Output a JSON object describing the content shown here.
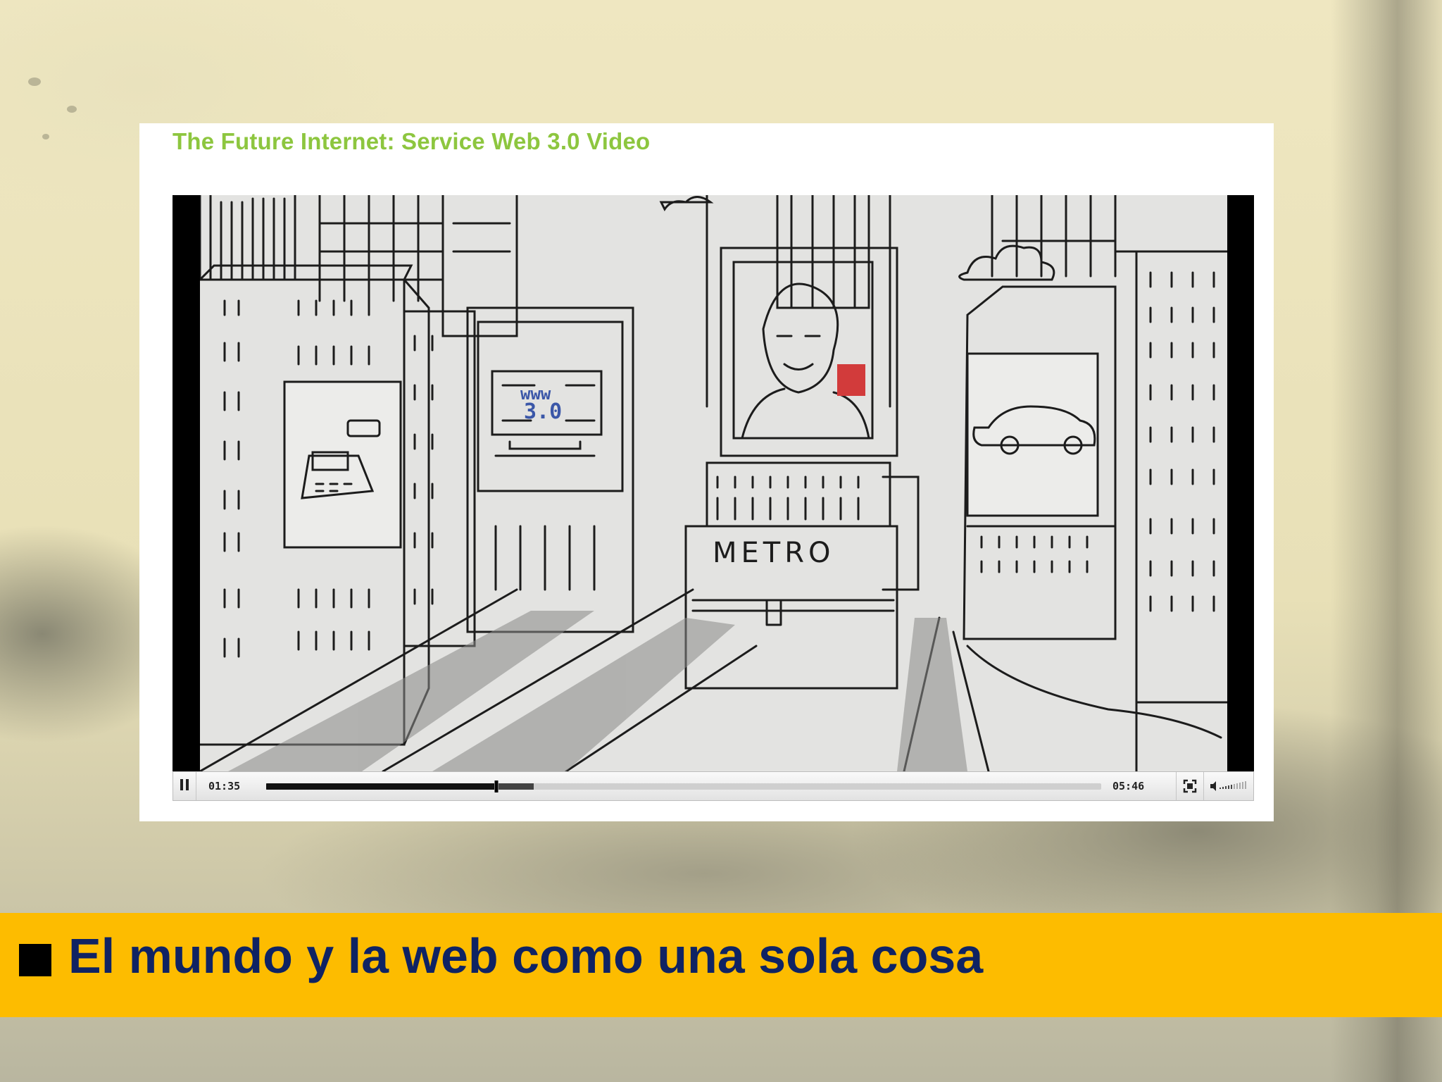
{
  "video": {
    "title": "The Future Internet: Service Web 3.0 Video",
    "current_time": "01:35",
    "total_time": "05:46",
    "progress_fraction": 0.275,
    "buffered_fraction": 0.32,
    "scene_labels": {
      "billboard_text_top": "www",
      "billboard_text_bottom": "3.0",
      "metro_sign": "METRO"
    }
  },
  "caption": {
    "text": "El mundo y la web como una sola cosa"
  },
  "colors": {
    "title_green": "#8dc63f",
    "caption_bar": "#fdbc00",
    "caption_text": "#0f2363"
  },
  "icons": {
    "pause": "pause-icon",
    "fullscreen": "fullscreen-icon",
    "volume": "volume-icon"
  }
}
